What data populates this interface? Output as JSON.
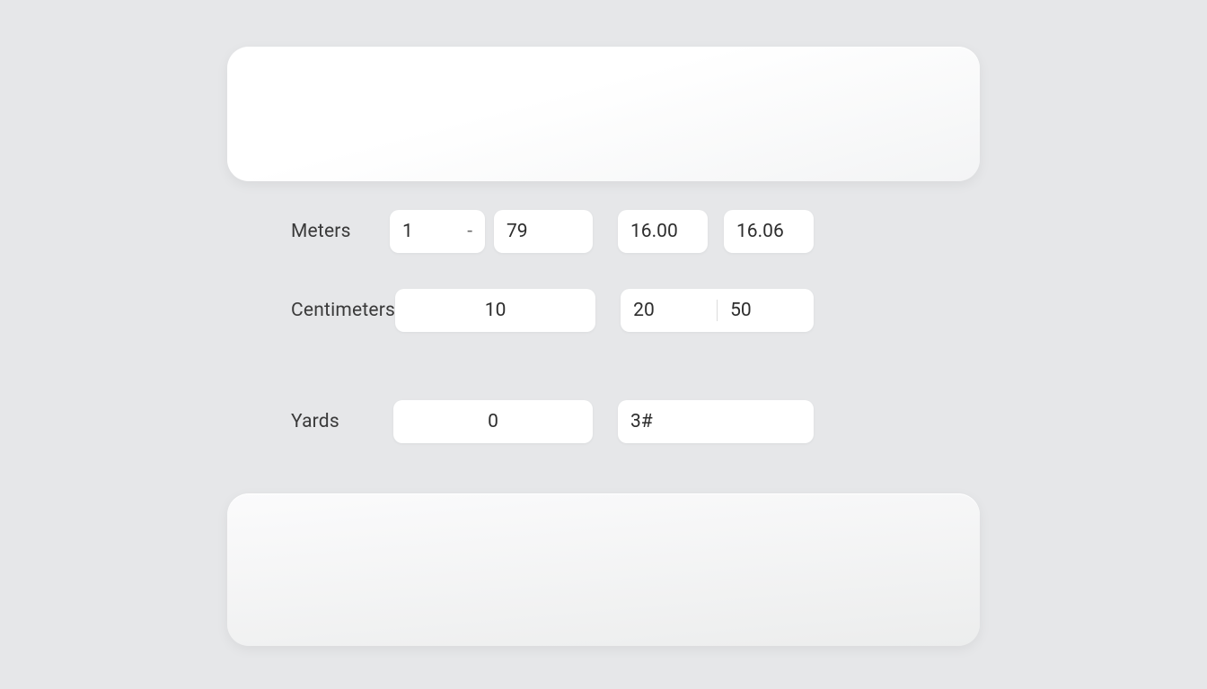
{
  "rows": {
    "meters": {
      "label": "Meters",
      "left_a": "1",
      "left_dash": "-",
      "left_b": "79",
      "mid": "16.00",
      "right": "16.06"
    },
    "centimeters": {
      "label": "Centimeters",
      "left": "10",
      "mid_a": "20",
      "mid_b": "50"
    },
    "yards": {
      "label": "Yards",
      "left": "0",
      "right": "3#"
    }
  }
}
